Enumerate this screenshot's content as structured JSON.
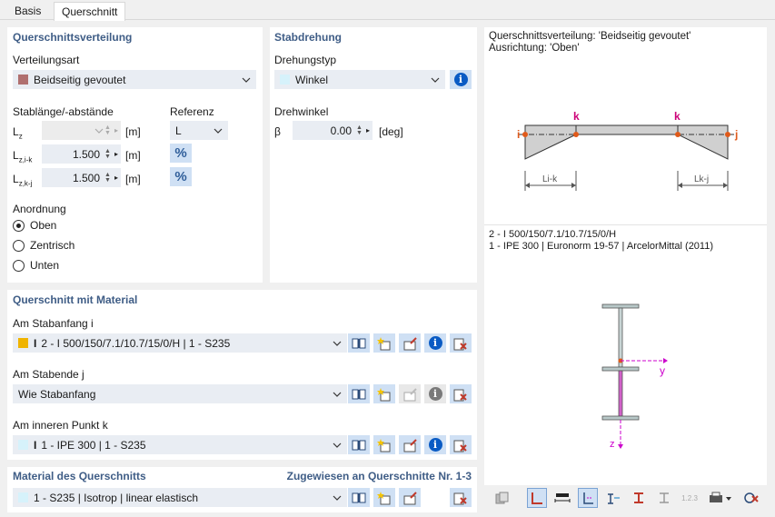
{
  "tabs": [
    {
      "label": "Basis"
    },
    {
      "label": "Querschnitt"
    }
  ],
  "dist": {
    "title": "Querschnittsverteilung",
    "type_label": "Verteilungsart",
    "type_value": "Beidseitig gevoutet",
    "type_color": "#b07070",
    "len_label": "Stablänge/-abstände",
    "ref_label": "Referenz",
    "rows": [
      {
        "sym": "Lz",
        "value": "",
        "unit": "[m]"
      },
      {
        "sym": "Lz,i-k",
        "value": "1.500",
        "unit": "[m]"
      },
      {
        "sym": "Lz,k-j",
        "value": "1.500",
        "unit": "[m]"
      }
    ],
    "ref_value": "L",
    "pct": "%",
    "arr_label": "Anordnung",
    "arr_options": [
      {
        "label": "Oben",
        "checked": true
      },
      {
        "label": "Zentrisch",
        "checked": false
      },
      {
        "label": "Unten",
        "checked": false
      }
    ]
  },
  "rot": {
    "title": "Stabdrehung",
    "type_label": "Drehungstyp",
    "type_value": "Winkel",
    "type_color": "#d6f2fb",
    "angle_label": "Drehwinkel",
    "sym": "β",
    "value": "0.00",
    "unit": "[deg]"
  },
  "section": {
    "title": "Querschnitt mit Material",
    "start_label": "Am Stabanfang i",
    "start_value": "2 - I 500/150/7.1/10.7/15/0/H | 1 - S235",
    "start_color": "#f0b400",
    "end_label": "Am Stabende j",
    "end_value": "Wie Stabanfang",
    "inner_label": "Am inneren Punkt k",
    "inner_value": "1 - IPE 300 | 1 - S235",
    "inner_color": "#d6f2fb"
  },
  "material": {
    "title": "Material des Querschnitts",
    "assigned": "Zugewiesen an Querschnitte Nr. 1-3",
    "value": "1 - S235 | Isotrop | linear elastisch",
    "color": "#d6f2fb"
  },
  "preview": {
    "line1": "Querschnittsverteilung: 'Beidseitig gevoutet'",
    "line2": "Ausrichtung: 'Oben'",
    "lab_i": "i",
    "lab_j": "j",
    "lab_k1": "k",
    "lab_k2": "k",
    "dim1": "Li-k",
    "dim2": "Lk-j",
    "sec1": "2 - I 500/150/7.1/10.7/15/0/H",
    "sec2": "1 - IPE 300 | Euronorm 19-57 | ArcelorMittal (2011)",
    "axis_y": "y",
    "axis_z": "z",
    "toolbar_text": "1.2.3"
  }
}
